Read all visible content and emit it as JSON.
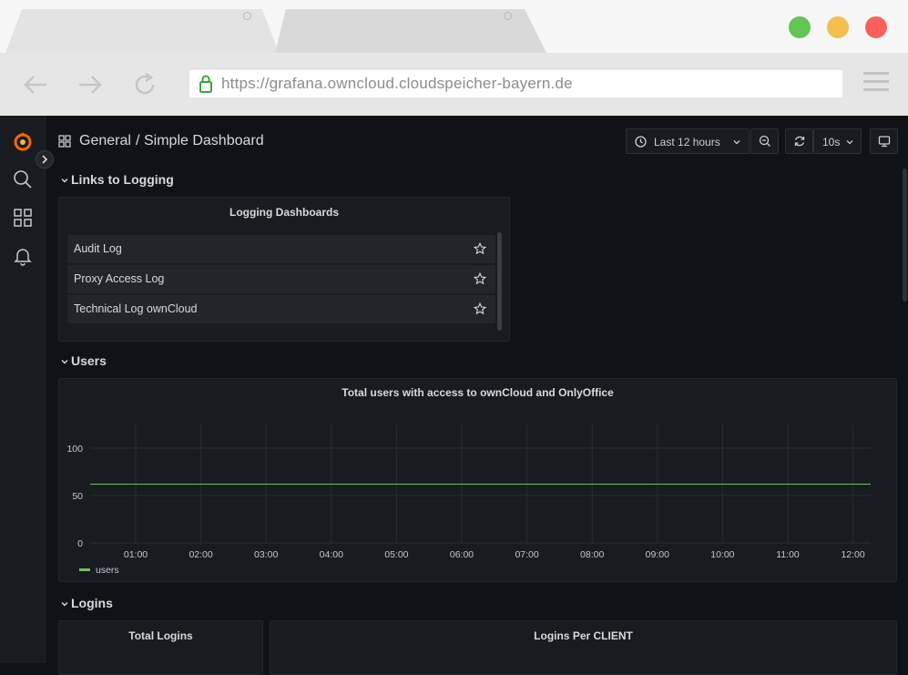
{
  "browser": {
    "url": "https://grafana.owncloud.cloudspeicher-bayern.de",
    "traffic_lights": {
      "green": "#62c554",
      "yellow": "#f4bf4f",
      "red": "#fc605c"
    }
  },
  "breadcrumb": {
    "folder": "General",
    "separator": "/",
    "dashboard": "Simple Dashboard"
  },
  "toolbar": {
    "time_range": "Last 12 hours",
    "refresh_interval": "10s"
  },
  "rows": [
    {
      "title": "Links to Logging"
    },
    {
      "title": "Users"
    },
    {
      "title": "Logins"
    }
  ],
  "dashlist": {
    "title": "Logging Dashboards",
    "items": [
      "Audit Log",
      "Proxy Access Log",
      "Technical Log ownCloud"
    ]
  },
  "users_panel": {
    "title": "Total users with access to ownCloud and OnlyOffice"
  },
  "logins_panels": {
    "total": "Total Logins",
    "per_client": "Logins Per CLIENT"
  },
  "chart_data": {
    "type": "line",
    "title": "Total users with access to ownCloud and OnlyOffice",
    "x_ticks": [
      "01:00",
      "02:00",
      "03:00",
      "04:00",
      "05:00",
      "06:00",
      "07:00",
      "08:00",
      "09:00",
      "10:00",
      "11:00",
      "12:00"
    ],
    "y_ticks": [
      "0",
      "50",
      "100"
    ],
    "ylim": [
      0,
      125
    ],
    "series": [
      {
        "name": "users",
        "color": "#73bf69",
        "values": [
          62,
          62,
          62,
          62,
          62,
          62,
          62,
          62,
          62,
          62,
          62,
          62,
          62
        ]
      }
    ],
    "legend_position": "bottom-left",
    "grid": true
  },
  "colors": {
    "grafana_orange": "#f46800",
    "series_green": "#73bf69"
  }
}
